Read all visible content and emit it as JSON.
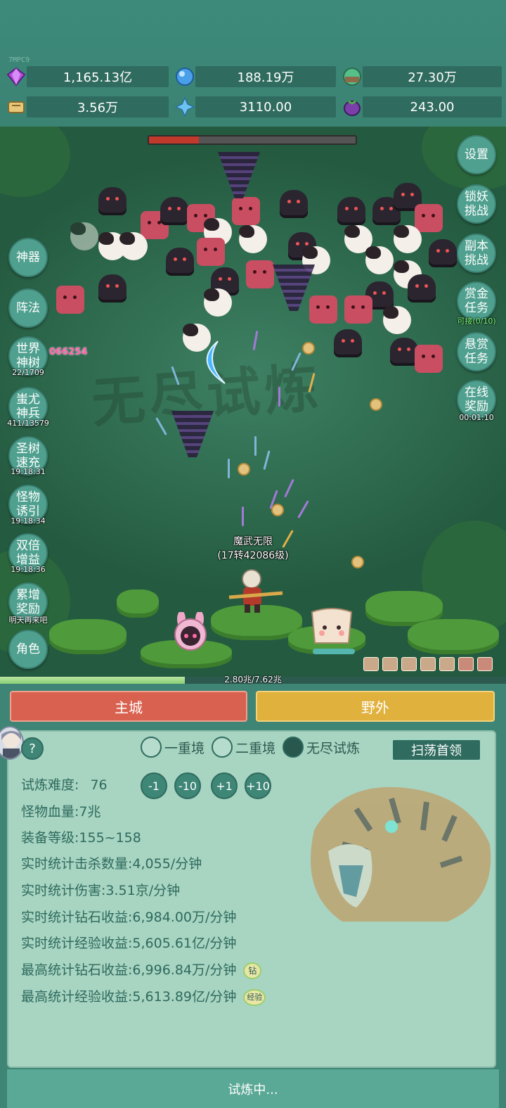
{
  "server_code": "7MPC9",
  "resources": [
    {
      "icon": "purple-diamond-icon",
      "value": "1,165.13亿"
    },
    {
      "icon": "blue-crystal-icon",
      "value": "188.19万"
    },
    {
      "icon": "green-orb-icon",
      "value": "27.30万"
    },
    {
      "icon": "scroll-icon",
      "value": "3.56万"
    },
    {
      "icon": "ice-crystal-icon",
      "value": "3110.00"
    },
    {
      "icon": "purple-eggplant-icon",
      "value": "243.00"
    }
  ],
  "battle": {
    "watermark": "无尽试炼",
    "boss_hp_fraction": 0.24,
    "hero_name": "魔武无限",
    "hero_level": "(17转42086级)",
    "damage_text": "066254",
    "exp_fraction": 0.365,
    "exp_text": "2.80兆/7.62兆"
  },
  "left_buttons": [
    {
      "label": "神器",
      "sub": ""
    },
    {
      "label": "阵法",
      "sub": ""
    },
    {
      "label": "世界神树",
      "sub": "22/1709"
    },
    {
      "label": "蚩尤神兵",
      "sub": "411/13579"
    },
    {
      "label": "圣树速充",
      "sub": "19:18:31"
    },
    {
      "label": "怪物诱引",
      "sub": "19:18:34"
    },
    {
      "label": "双倍增益",
      "sub": "19:18:36"
    },
    {
      "label": "累增奖励",
      "sub": "明天再来吧"
    },
    {
      "label": "角色",
      "sub": ""
    }
  ],
  "right_buttons": [
    {
      "label": "设置",
      "sub": ""
    },
    {
      "label": "锁妖挑战",
      "sub": ""
    },
    {
      "label": "副本挑战",
      "sub": ""
    },
    {
      "label": "赏金任务",
      "sub": "可接(0/10)"
    },
    {
      "label": "悬赏任务",
      "sub": ""
    },
    {
      "label": "在线奖励",
      "sub": "00:01:10"
    }
  ],
  "tabs": {
    "main_city": "主城",
    "wild": "野外"
  },
  "panel": {
    "help": "?",
    "radios": [
      {
        "label": "一重境",
        "checked": false
      },
      {
        "label": "二重境",
        "checked": false
      },
      {
        "label": "无尽试炼",
        "checked": true
      }
    ],
    "sweep_button": "扫荡首领",
    "difficulty_label": "试炼难度:",
    "difficulty_value": "76",
    "difficulty_buttons": [
      "-1",
      "-10",
      "+1",
      "+10"
    ],
    "stats": [
      {
        "label": "怪物血量:",
        "value": "7兆"
      },
      {
        "label": "装备等级:",
        "value": "155~158"
      },
      {
        "label": "实时统计击杀数量:",
        "value": "4,055/分钟"
      },
      {
        "label": "实时统计伤害:",
        "value": "3.51京/分钟"
      },
      {
        "label": "实时统计钻石收益:",
        "value": "6,984.00万/分钟"
      },
      {
        "label": "实时统计经验收益:",
        "value": "5,605.61亿/分钟"
      },
      {
        "label": "最高统计钻石收益:",
        "value": "6,996.84万/分钟",
        "badge": "钻"
      },
      {
        "label": "最高统计经验收益:",
        "value": "5,613.89亿/分钟",
        "badge": "经验"
      }
    ]
  },
  "status_text": "试炼中...",
  "colors": {
    "main_city_tab": "#d9614f",
    "wild_tab": "#e0b13d",
    "panel_bg": "#a8d4c2",
    "accent": "#2f6b5e"
  }
}
